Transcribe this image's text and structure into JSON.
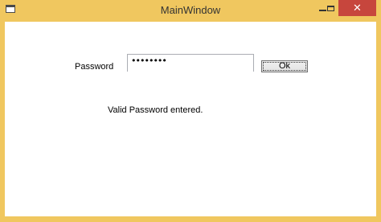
{
  "window": {
    "title": "MainWindow",
    "frame_color": "#f0c75f",
    "close_color": "#c7463d"
  },
  "form": {
    "password_label": "Password",
    "password_mask": "••••••••",
    "ok_label": "Ok",
    "status_message": "Valid Password entered."
  },
  "icons": {
    "app": "window-icon",
    "minimize": "minimize-icon",
    "maximize": "maximize-icon",
    "close": "close-icon"
  }
}
